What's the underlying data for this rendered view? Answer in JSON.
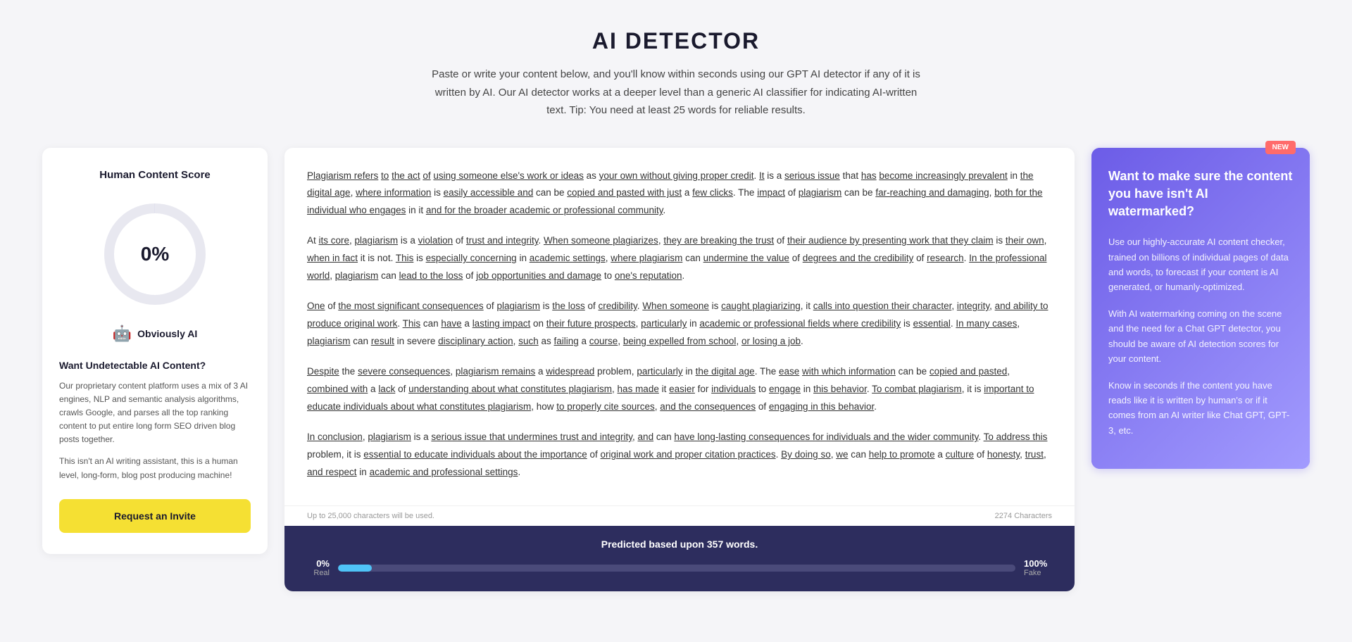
{
  "header": {
    "title": "AI DETECTOR",
    "description": "Paste or write your content below, and you'll know within seconds using our GPT AI detector if any of it is written by AI. Our AI detector works at a deeper level than a generic AI classifier for indicating AI-written text. Tip: You need at least 25 words for reliable results."
  },
  "left_panel": {
    "title": "Human Content Score",
    "score": "0%",
    "ai_label": "Obviously AI",
    "want_undetectable_title": "Want Undetectable AI Content?",
    "description1": "Our proprietary content platform uses a mix of 3 AI engines, NLP and semantic analysis algorithms, crawls Google, and parses all the top ranking content to put entire long form SEO driven blog posts together.",
    "description2": "This isn't an AI writing assistant, this is a human level, long-form, blog post producing machine!",
    "button_label": "Request an Invite"
  },
  "center_panel": {
    "paragraphs": [
      "Plagiarism refers to the act of using someone else's work or ideas as your own without giving proper credit. It is a serious issue that has become increasingly prevalent in the digital age, where information is easily accessible and can be copied and pasted with just a few clicks. The impact of plagiarism can be far-reaching and damaging, both for the individual who engages in it and for the broader academic or professional community.",
      "At its core, plagiarism is a violation of trust and integrity. When someone plagiarizes, they are breaking the trust of their audience by presenting work that they claim is their own, when in fact it is not. This is especially concerning in academic settings, where plagiarism can undermine the value of degrees and the credibility of research. In the professional world, plagiarism can lead to the loss of job opportunities and damage to one's reputation.",
      "One of the most significant consequences of plagiarism is the loss of credibility. When someone is caught plagiarizing, it calls into question their character, integrity, and ability to produce original work. This can have a lasting impact on their future prospects, particularly in academic or professional fields where credibility is essential. In many cases, plagiarism can result in severe disciplinary action, such as failing a course, being expelled from school, or losing a job.",
      "Despite the severe consequences, plagiarism remains a widespread problem, particularly in the digital age. The ease with which information can be copied and pasted, combined with a lack of understanding about what constitutes plagiarism, has made it easier for individuals to engage in this behavior. To combat plagiarism, it is important to educate individuals about what constitutes plagiarism, how to properly cite sources, and the consequences of engaging in this behavior.",
      "In conclusion, plagiarism is a serious issue that undermines trust and integrity, and can have long-lasting consequences for individuals and the wider community. To address this problem, it is essential to educate individuals about the importance of original work and proper citation practices. By doing so, we can help to promote a culture of honesty, trust, and respect in academic and professional settings."
    ],
    "chars_label": "Up to 25,000 characters will be used.",
    "chars_count": "2274 Characters",
    "progress": {
      "label": "Predicted based upon 357 words.",
      "real_pct": "0%",
      "real_label": "Real",
      "fake_pct": "100%",
      "fake_label": "Fake",
      "fill_width": "5%"
    }
  },
  "right_panel": {
    "badge": "NEW",
    "title": "Want to make sure the content you have isn't AI watermarked?",
    "para1": "Use our highly-accurate AI content checker, trained on billions of individual pages of data and words, to forecast if your content is AI generated, or humanly-optimized.",
    "para2": "With AI watermarking coming on the scene and the need for a Chat GPT detector, you should be aware of AI detection scores for your content.",
    "para3": "Know in seconds if the content you have reads like it is written by human's or if it comes from an AI writer like Chat GPT, GPT-3, etc."
  },
  "icons": {
    "robot": "🤖"
  }
}
